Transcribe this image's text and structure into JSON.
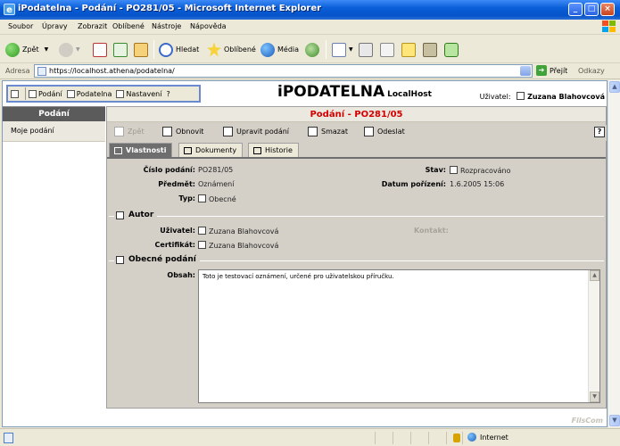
{
  "window": {
    "title": "iPodatelna - Podání - PO281/05 - Microsoft Internet Explorer",
    "controls": [
      "_",
      "□",
      "×"
    ]
  },
  "menu": [
    "Soubor",
    "Úpravy",
    "Zobrazit",
    "Oblíbené",
    "Nástroje",
    "Nápověda"
  ],
  "toolbar": {
    "back": "Zpět",
    "search": "Hledat",
    "favorites": "Oblíbené",
    "media": "Média"
  },
  "address": {
    "label": "Adresa",
    "url": "https://localhost.athena/podatelna/",
    "go": "Přejít",
    "links": "Odkazy"
  },
  "app": {
    "toolbar": {
      "podani": "Podání",
      "podatelna": "Podatelna",
      "nastaveni": "Nastavení",
      "help": "?"
    },
    "brand_main": "iPODATELNA",
    "brand_sub": "LocalHost",
    "user_label": "Uživatel:",
    "user_name": "Zuzana Blahovcová"
  },
  "sidebar": {
    "title": "Podání",
    "items": [
      {
        "label": "Moje podání"
      }
    ]
  },
  "main": {
    "title": "Podání - PO281/05",
    "actions": {
      "back": "Zpět",
      "refresh": "Obnovit",
      "edit": "Upravit podání",
      "delete": "Smazat",
      "send": "Odeslat",
      "help": "?"
    },
    "tabs": [
      "Vlastnosti",
      "Dokumenty",
      "Historie"
    ],
    "fields": {
      "cislo_label": "Číslo podání:",
      "cislo_value": "PO281/05",
      "predmet_label": "Předmět:",
      "predmet_value": "Oznámení",
      "typ_label": "Typ:",
      "typ_value": "Obecné",
      "stav_label": "Stav:",
      "stav_value": "Rozpracováno",
      "datum_label": "Datum pořízení:",
      "datum_value": "1.6.2005 15:06"
    },
    "autor": {
      "section": "Autor",
      "uzivatel_label": "Uživatel:",
      "uzivatel_value": "Zuzana Blahovcová",
      "kontakt_label": "Kontakt:",
      "certifikat_label": "Certifikát:",
      "certifikat_value": "Zuzana Blahovcová"
    },
    "obecne": {
      "section": "Obecné podání",
      "obsah_label": "Obsah:",
      "obsah_value": "Toto je testovací oznámení, určené pro uživatelskou příručku."
    },
    "watermark": "FilsCom"
  },
  "status": {
    "zone": "Internet"
  }
}
